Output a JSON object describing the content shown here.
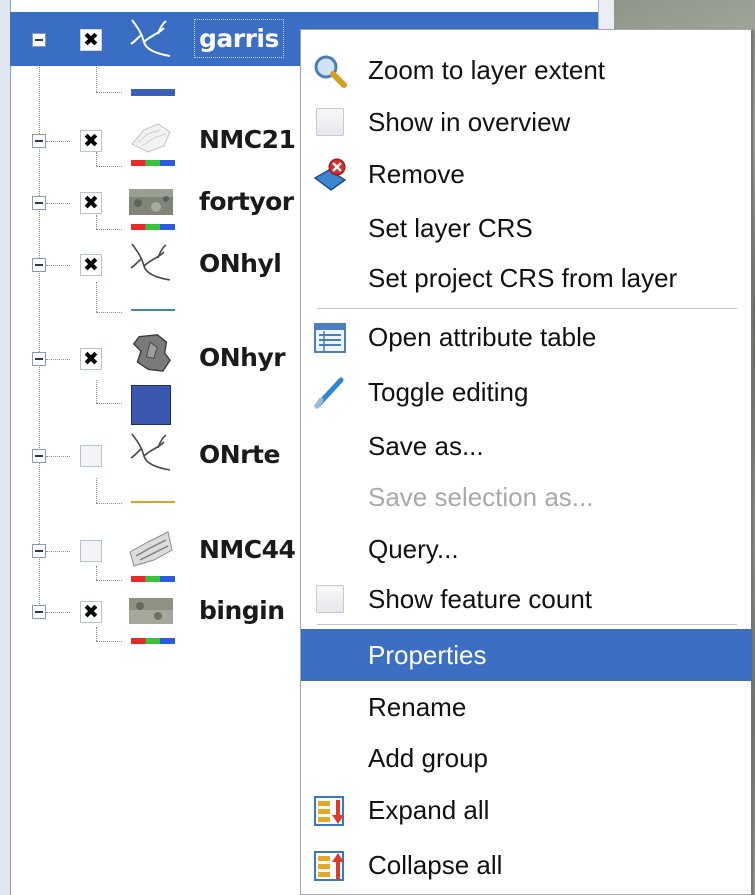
{
  "layers": [
    {
      "name": "garrison_rd_ontario",
      "visible_name": "garris",
      "checked": true,
      "selected": true,
      "icon": "line-layer-icon",
      "legend": "blue-line"
    },
    {
      "name": "NMC21",
      "visible_name": "NMC21",
      "checked": true,
      "selected": false,
      "icon": "raster-layer-icon",
      "legend": "rgb-bar"
    },
    {
      "name": "fortyor",
      "visible_name": "fortyor",
      "checked": true,
      "selected": false,
      "icon": "raster-layer-icon",
      "legend": "rgb-bar"
    },
    {
      "name": "ONhyl",
      "visible_name": "ONhyl",
      "checked": true,
      "selected": false,
      "icon": "line-layer-icon",
      "legend": "teal-line"
    },
    {
      "name": "ONhyr",
      "visible_name": "ONhyr",
      "checked": true,
      "selected": false,
      "icon": "polygon-layer-icon",
      "legend": "blue-fill"
    },
    {
      "name": "ONrte",
      "visible_name": "ONrte",
      "checked": false,
      "selected": false,
      "icon": "line-layer-icon",
      "legend": "orange-line"
    },
    {
      "name": "NMC44",
      "visible_name": "NMC44",
      "checked": false,
      "selected": false,
      "icon": "raster-layer-icon",
      "legend": "rgb-bar"
    },
    {
      "name": "bingin",
      "visible_name": "bingin",
      "checked": true,
      "selected": false,
      "icon": "raster-layer-icon",
      "legend": "rgb-bar"
    }
  ],
  "checkbox_mark": "✖",
  "context_menu": {
    "items": [
      {
        "label": "Zoom to layer extent",
        "icon": "zoom-extent-icon",
        "enabled": true
      },
      {
        "label": "Show in overview",
        "icon": "checkbox-icon",
        "enabled": true
      },
      {
        "label": "Remove",
        "icon": "remove-layer-icon",
        "enabled": true
      },
      {
        "label": "Set layer CRS",
        "icon": "",
        "enabled": true
      },
      {
        "label": "Set project CRS from layer",
        "icon": "",
        "enabled": true
      },
      {
        "label": "Open attribute table",
        "icon": "attribute-table-icon",
        "enabled": true
      },
      {
        "label": "Toggle editing",
        "icon": "pencil-icon",
        "enabled": true
      },
      {
        "label": "Save as...",
        "icon": "",
        "enabled": true
      },
      {
        "label": "Save selection as...",
        "icon": "",
        "enabled": false
      },
      {
        "label": "Query...",
        "icon": "",
        "enabled": true
      },
      {
        "label": "Show feature count",
        "icon": "checkbox-icon",
        "enabled": true
      },
      {
        "label": "Properties",
        "icon": "",
        "enabled": true,
        "highlighted": true
      },
      {
        "label": "Rename",
        "icon": "",
        "enabled": true
      },
      {
        "label": "Add group",
        "icon": "",
        "enabled": true
      },
      {
        "label": "Expand all",
        "icon": "expand-all-icon",
        "enabled": true
      },
      {
        "label": "Collapse all",
        "icon": "collapse-all-icon",
        "enabled": true
      }
    ]
  },
  "colors": {
    "selection": "#3a6ec4",
    "menu_highlight": "#3c6fc2",
    "disabled_text": "#a9a9a9"
  }
}
